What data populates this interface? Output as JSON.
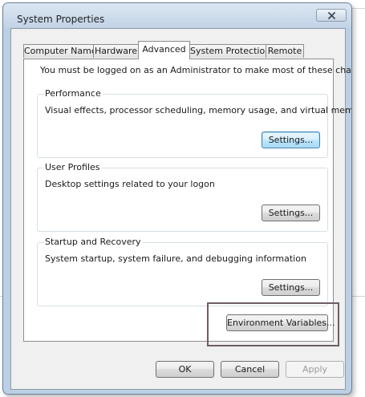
{
  "window": {
    "title": "System Properties",
    "close_label": "✕"
  },
  "tabs": [
    {
      "label": "Computer Name",
      "active": false
    },
    {
      "label": "Hardware",
      "active": false
    },
    {
      "label": "Advanced",
      "active": true
    },
    {
      "label": "System Protection",
      "active": false
    },
    {
      "label": "Remote",
      "active": false
    }
  ],
  "advanced": {
    "admin_note": "You must be logged on as an Administrator to make most of these changes.",
    "performance": {
      "title": "Performance",
      "description": "Visual effects, processor scheduling, memory usage, and virtual memory",
      "settings_label": "Settings..."
    },
    "user_profiles": {
      "title": "User Profiles",
      "description": "Desktop settings related to your logon",
      "settings_label": "Settings..."
    },
    "startup_recovery": {
      "title": "Startup and Recovery",
      "description": "System startup, system failure, and debugging information",
      "settings_label": "Settings..."
    },
    "env_vars_label": "Environment Variables..."
  },
  "footer": {
    "ok_label": "OK",
    "cancel_label": "Cancel",
    "apply_label": "Apply"
  }
}
